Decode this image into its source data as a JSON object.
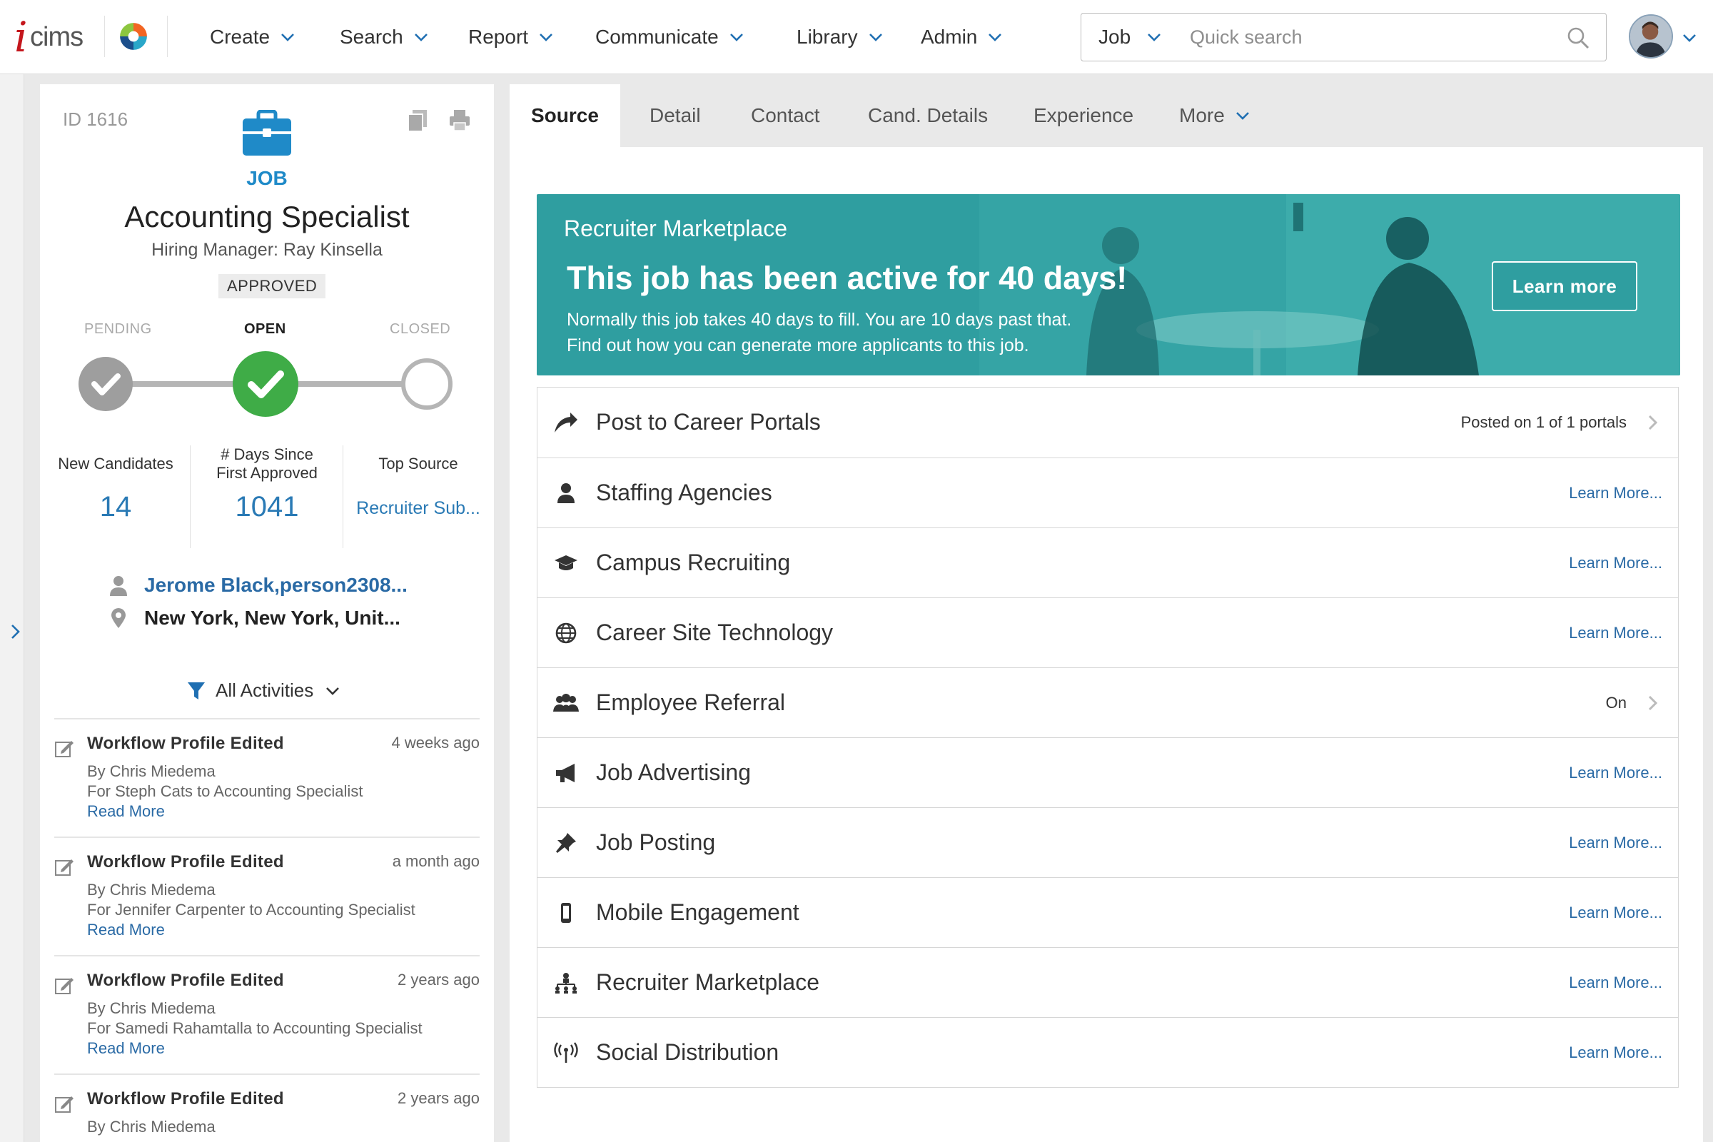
{
  "header": {
    "logo_text": "icims",
    "nav": [
      {
        "label": "Create"
      },
      {
        "label": "Search"
      },
      {
        "label": "Report"
      },
      {
        "label": "Communicate"
      },
      {
        "label": "Library"
      },
      {
        "label": "Admin"
      }
    ],
    "search_type": "Job",
    "search_placeholder": "Quick search"
  },
  "job": {
    "id_label": "ID 1616",
    "type_label": "JOB",
    "title": "Accounting Specialist",
    "hiring_manager": "Hiring Manager: Ray Kinsella",
    "status": "APPROVED",
    "stages": {
      "pending": "PENDING",
      "open": "OPEN",
      "closed": "CLOSED"
    },
    "stats": {
      "new_candidates_label": "New Candidates",
      "new_candidates_value": "14",
      "days_label_1": "# Days Since",
      "days_label_2": "First Approved",
      "days_value": "1041",
      "top_source_label": "Top Source",
      "top_source_value": "Recruiter Sub..."
    },
    "recruiter": "Jerome Black,person2308...",
    "location": "New York, New York, Unit..."
  },
  "activity": {
    "filter_label": "All Activities",
    "items": [
      {
        "title": "Workflow Profile Edited",
        "time": "4 weeks ago",
        "by": "By Chris Miedema",
        "detail": "For Steph Cats to Accounting Specialist",
        "link": "Read More"
      },
      {
        "title": "Workflow Profile Edited",
        "time": "a month ago",
        "by": "By Chris Miedema",
        "detail": "For Jennifer Carpenter to Accounting Specialist",
        "link": "Read More"
      },
      {
        "title": "Workflow Profile Edited",
        "time": "2 years ago",
        "by": "By Chris Miedema",
        "detail": "For Samedi Rahamtalla to Accounting Specialist",
        "link": "Read More"
      },
      {
        "title": "Workflow Profile Edited",
        "time": "2 years ago",
        "by": "By Chris Miedema",
        "detail": "",
        "link": ""
      }
    ]
  },
  "tabs": [
    {
      "label": "Source"
    },
    {
      "label": "Detail"
    },
    {
      "label": "Contact"
    },
    {
      "label": "Cand. Details"
    },
    {
      "label": "Experience"
    },
    {
      "label": "More"
    }
  ],
  "banner": {
    "subtitle": "Recruiter Marketplace",
    "headline": "This job has been active for 40 days!",
    "line1": "Normally this job takes 40 days to fill. You are 10 days past that.",
    "line2": "Find out how you can generate more applicants to this job.",
    "button": "Learn more",
    "color": "#2f9ea0"
  },
  "sources": [
    {
      "icon": "share-arrow-icon",
      "label": "Post to Career Portals",
      "status": "Posted on 1 of 1 portals",
      "action": ""
    },
    {
      "icon": "person-icon",
      "label": "Staffing Agencies",
      "status": "",
      "action": "Learn More..."
    },
    {
      "icon": "graduation-cap-icon",
      "label": "Campus Recruiting",
      "status": "",
      "action": "Learn More..."
    },
    {
      "icon": "globe-icon",
      "label": "Career Site Technology",
      "status": "",
      "action": "Learn More..."
    },
    {
      "icon": "group-icon",
      "label": "Employee Referral",
      "status": "On",
      "action": ""
    },
    {
      "icon": "megaphone-icon",
      "label": "Job Advertising",
      "status": "",
      "action": "Learn More..."
    },
    {
      "icon": "pushpin-icon",
      "label": "Job Posting",
      "status": "",
      "action": "Learn More..."
    },
    {
      "icon": "mobile-icon",
      "label": "Mobile Engagement",
      "status": "",
      "action": "Learn More..."
    },
    {
      "icon": "network-icon",
      "label": "Recruiter Marketplace",
      "status": "",
      "action": "Learn More..."
    },
    {
      "icon": "broadcast-icon",
      "label": "Social Distribution",
      "status": "",
      "action": "Learn More..."
    }
  ],
  "colors": {
    "accent": "#2a6aa5",
    "link": "#2a7ab5",
    "open_green": "#3fac47",
    "brand_red": "#c4161c"
  }
}
